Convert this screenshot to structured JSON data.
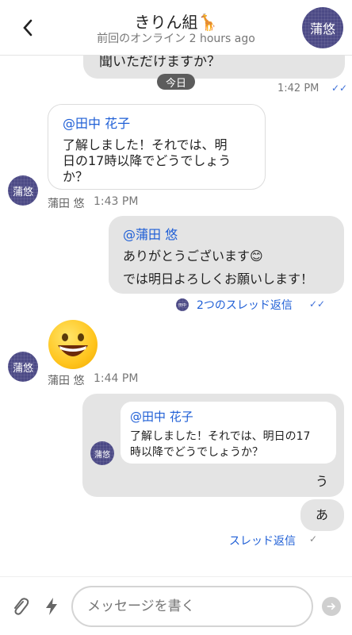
{
  "header": {
    "title": "きりん組🦒",
    "subtitle": "前回のオンライン 2 hours ago",
    "avatar_text": "蒲悠"
  },
  "messages": {
    "prev_text": "聞いただけますか？",
    "prev_time": "1:42 PM",
    "divider": "今日",
    "m1": {
      "mention": "@田中 花子",
      "lines": [
        "了解しました！それでは、明",
        "日の17時以降でどうでしょう",
        "か？"
      ],
      "avatar": "蒲悠",
      "sender": "蒲田 悠",
      "time": "1:43 PM"
    },
    "m2": {
      "mention": "@蒲田 悠",
      "lines": [
        "ありがとうございます😊",
        "では明日よろしくお願いします！"
      ],
      "thread_mini_avatar": "田中",
      "thread_label": "2つのスレッド返信"
    },
    "m3": {
      "emoji": "😄",
      "avatar": "蒲悠",
      "sender": "蒲田 悠",
      "time": "1:44 PM"
    },
    "m4": {
      "quote_mention": "@田中 花子",
      "quote_lines": [
        "了解しました！それでは、明日の17",
        "時以降でどうでしょうか？"
      ],
      "quote_avatar": "蒲悠",
      "reply": "う"
    },
    "m5": {
      "text": "あ",
      "thread_label": "スレッド返信"
    }
  },
  "composer": {
    "placeholder": "メッセージを書く"
  },
  "icons": {
    "back": "chevron-left-icon",
    "attach": "paperclip-icon",
    "quick": "lightning-icon",
    "send": "send-arrow-icon",
    "read": "double-check-icon"
  },
  "colors": {
    "accent": "#1f5fd6",
    "avatar": "#4c4a86",
    "bubble_gray": "#e4e4e4"
  }
}
